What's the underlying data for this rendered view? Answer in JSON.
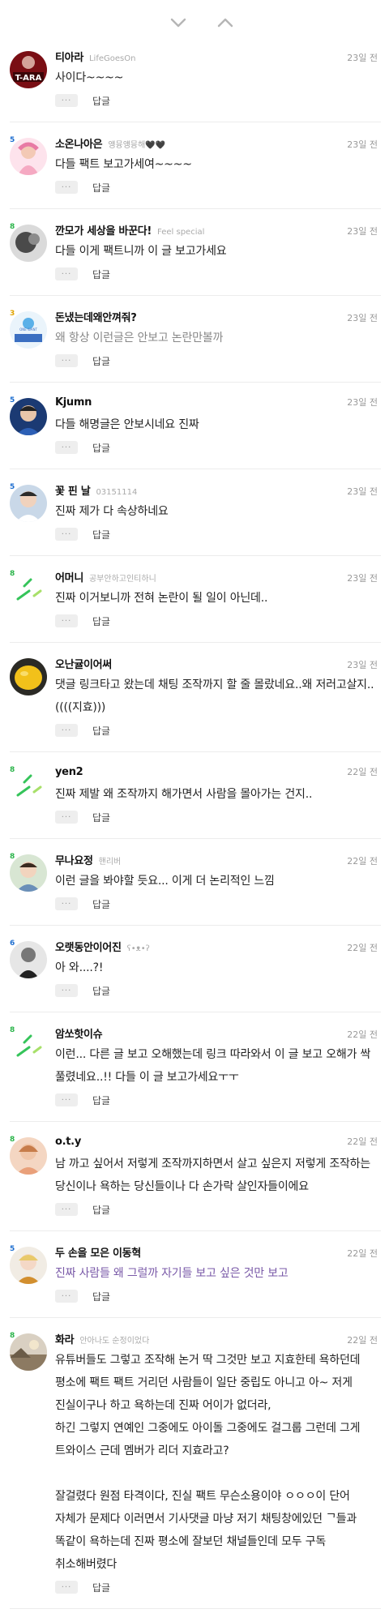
{
  "nav": {
    "down_icon": "chevron-down",
    "up_icon": "chevron-up"
  },
  "actions": {
    "more": "···",
    "reply": "답글"
  },
  "comments": [
    {
      "nick": "티아라",
      "sub": "LifeGoesOn",
      "time": "23일 전",
      "text": "사이다~~~~",
      "style": "normal",
      "level": "",
      "avatar": "tara"
    },
    {
      "nick": "소온나아은",
      "sub": "얭뮹얭뮹해🖤🖤",
      "time": "23일 전",
      "text": "다들 팩트 보고가세여~~~~",
      "style": "normal",
      "level": "5",
      "avatar": "pink"
    },
    {
      "nick": "깐모가 세상을 바꾼다!",
      "sub": "Feel special",
      "time": "23일 전",
      "text": "다들 이게 팩트니까 이 글 보고가세요",
      "style": "normal",
      "level": "8",
      "avatar": "gray"
    },
    {
      "nick": "돈냈는데왜안껴줘?",
      "sub": "",
      "time": "23일 전",
      "text": "왜 항상 이런글은 안보고 논란만볼까",
      "style": "muted",
      "level": "3",
      "avatar": "blue"
    },
    {
      "nick": "Kjumn",
      "sub": "",
      "time": "23일 전",
      "text": "다들 해명글은 안보시네요 진짜",
      "style": "normal",
      "level": "5",
      "avatar": "dark"
    },
    {
      "nick": "꽃 핀 날",
      "sub": "03151114",
      "time": "23일 전",
      "text": "진짜 제가 다 속상하네요",
      "style": "normal",
      "level": "5",
      "avatar": "person"
    },
    {
      "nick": "어머니",
      "sub": "공부안하고인티하니",
      "time": "23일 전",
      "text": "진짜 이거보니까 전혀 논란이 될 일이 아닌데..",
      "style": "normal",
      "level": "8",
      "avatar": "default"
    },
    {
      "nick": "오난귤이어써",
      "sub": "",
      "time": "23일 전",
      "text": "댓글 링크타고 왔는데 채팅 조작까지 할 줄 몰랐네요..왜 저러고살지..\n((((지효)))",
      "style": "normal",
      "level": "",
      "avatar": "lemon"
    },
    {
      "nick": "yen2",
      "sub": "",
      "time": "22일 전",
      "text": "진짜 제발 왜 조작까지 해가면서 사람을 몰아가는 건지..",
      "style": "normal",
      "level": "8",
      "avatar": "default"
    },
    {
      "nick": "무나요정",
      "sub": "핸리버",
      "time": "22일 전",
      "text": "이런 글을 봐야할 듯요... 이게 더 논리적인 느낌",
      "style": "normal",
      "level": "8",
      "avatar": "boy"
    },
    {
      "nick": "오랫동안이어진",
      "sub": "ʕ•ᴥ•ʔ",
      "time": "22일 전",
      "text": "아 와....?!",
      "style": "normal",
      "level": "6",
      "avatar": "bw"
    },
    {
      "nick": "암쏘핫이슈",
      "sub": "",
      "time": "22일 전",
      "text": "이런... 다른 글 보고 오해했는데 링크 따라와서 이 글 보고 오해가 싹 풀렸네요..!! 다들 이 글 보고가세요ㅜㅜ",
      "style": "normal",
      "level": "8",
      "avatar": "default"
    },
    {
      "nick": "o.t.y",
      "sub": "",
      "time": "22일 전",
      "text": "남 까고 싶어서 저렇게 조작까지하면서 살고 싶은지 저렇게 조작하는 당신이나 욕하는 당신들이나 다 손가락 살인자들이에요",
      "style": "normal",
      "level": "8",
      "avatar": "warm"
    },
    {
      "nick": "두 손을 모은 이동혁",
      "sub": "",
      "time": "22일 전",
      "text": "진짜 사람들 왜 그럴까 자기들 보고 싶은 것만 보고",
      "style": "link",
      "level": "5",
      "avatar": "blond"
    },
    {
      "nick": "화라",
      "sub": "안아나도 순정이었다",
      "time": "22일 전",
      "text": "유튜버들도 그렇고 조작해 논거 딱 그것만 보고 지효한테 욕하던데 평소에 팩트 팩트 거리던 사람들이 일단 중립도 아니고 아~ 저게 진실이구나 하고 욕하는데 진짜 어이가 없더라,\n하긴 그렇지 연예인 그중에도 아이돌 그중에도 걸그룹 그런데 그게 트와이스 근데 멤버가 리더 지효라고?\n\n잘걸렸다 원점 타격이다, 진실 팩트 무슨소용이야 ㅇㅇㅇ이 단어 자체가 문제다 이러면서 기사댓글 마냥 저기 채팅창에있던 ᄀ들과 똑같이 욕하는데 진짜 평소에 잘보던 채널들인데 모두 구독 취소해버렸다",
      "style": "normal",
      "level": "8",
      "avatar": "landscape"
    }
  ]
}
